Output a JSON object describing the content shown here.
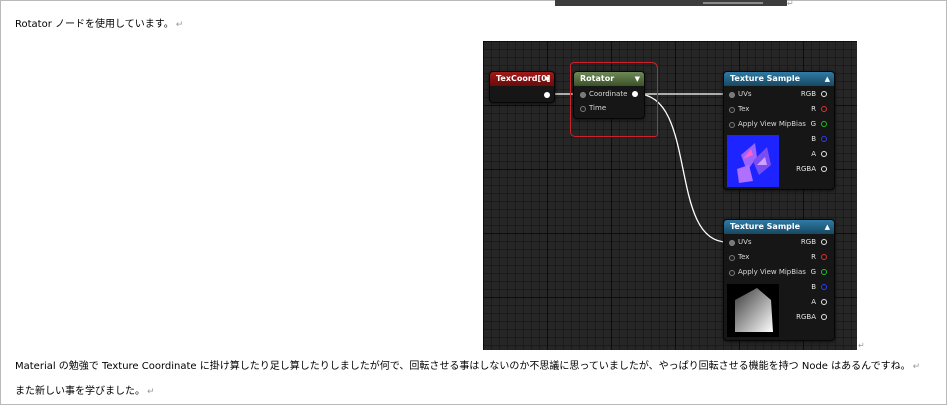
{
  "doc": {
    "line1": "Rotator ノードを使用しています。",
    "line2": "Material の勉強で Texture Coordinate に掛け算したり足し算したりしましたが何で、回転させる事はしないのか不思議に思っていましたが、やっぱり回転させる機能を持つ Node はあるんですね。",
    "line3": "また新しい事を学びました。",
    "return_mark": "↵"
  },
  "graph": {
    "nodes": {
      "texcoord": {
        "title": "TexCoord[0]",
        "color": "#7a1010"
      },
      "rotator": {
        "title": "Rotator",
        "color": "#4e6a3a",
        "pins": [
          "Coordinate",
          "Time"
        ]
      },
      "texsample1": {
        "title": "Texture Sample",
        "color": "#1e5f84",
        "inputs": [
          "UVs",
          "Tex",
          "Apply View MipBias"
        ],
        "outputs": [
          "RGB",
          "R",
          "G",
          "B",
          "A",
          "RGBA"
        ]
      },
      "texsample2": {
        "title": "Texture Sample",
        "color": "#1e5f84",
        "inputs": [
          "UVs",
          "Tex",
          "Apply View MipBias"
        ],
        "outputs": [
          "RGB",
          "R",
          "G",
          "B",
          "A",
          "RGBA"
        ]
      }
    },
    "output_colors": {
      "RGB": "#e6e6e6",
      "R": "#e03030",
      "G": "#20c020",
      "B": "#2a3cff",
      "A": "#e6e6e6",
      "RGBA": "#e6e6e6"
    },
    "highlight_color": "#d0202a"
  }
}
